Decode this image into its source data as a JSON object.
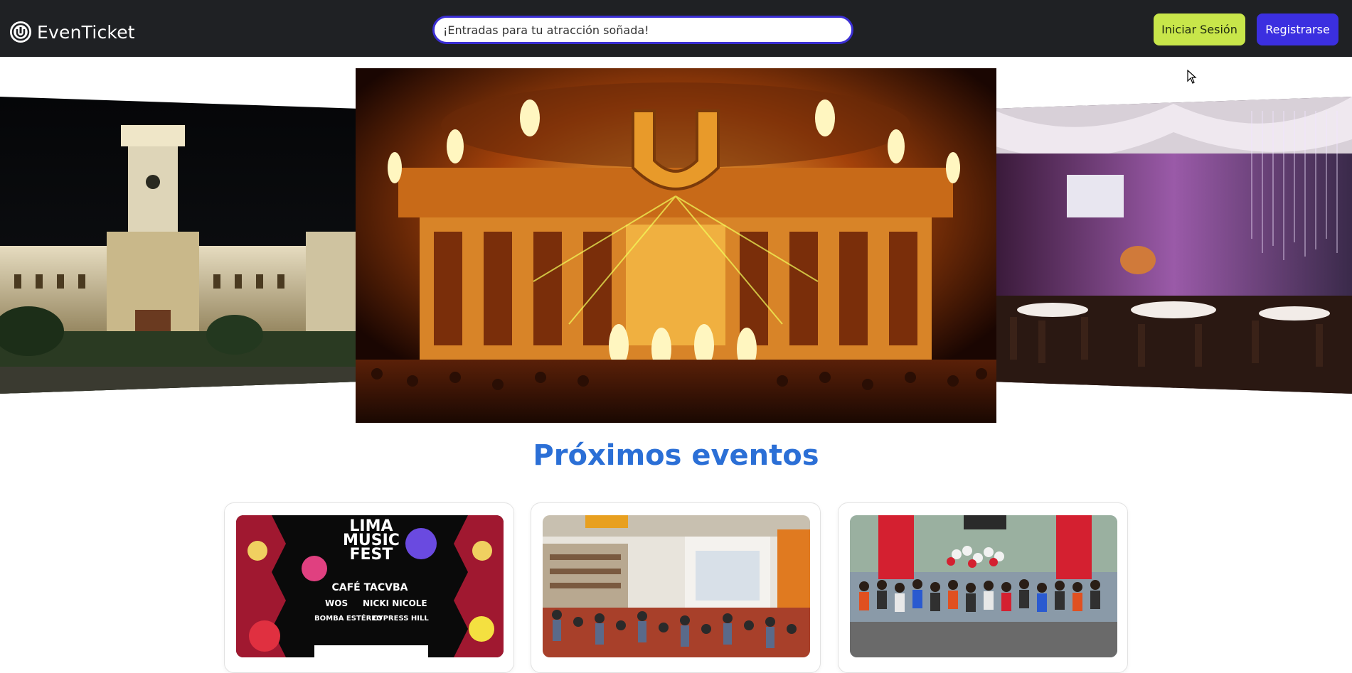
{
  "header": {
    "brand": "EvenTicket",
    "search_placeholder": "¡Entradas para tu atracción soñada!",
    "login_label": "Iniciar Sesión",
    "register_label": "Registrarse"
  },
  "hero": {
    "slides": [
      {
        "icon": "municipal-palace-image"
      },
      {
        "icon": "ultra-festival-stage-image"
      },
      {
        "icon": "event-hall-image"
      }
    ]
  },
  "section": {
    "title": "Próximos eventos"
  },
  "events": [
    {
      "icon": "lima-music-fest-poster",
      "poster": {
        "line1": "LIMA",
        "line2": "MUSIC",
        "line3": "FEST",
        "headliner": "CAFÉ TACVBA",
        "acts1": "WOS",
        "acts2": "NICKI NICOLE",
        "acts3": "BOMBA ESTÉREO",
        "acts4": "CYPRESS HILL"
      }
    },
    {
      "icon": "book-fair-photo"
    },
    {
      "icon": "marathon-photo"
    }
  ],
  "colors": {
    "header_bg": "#1f2124",
    "accent_blue": "#3b2fe0",
    "accent_lime": "#c8e64a",
    "title_blue": "#2b6fd6"
  }
}
